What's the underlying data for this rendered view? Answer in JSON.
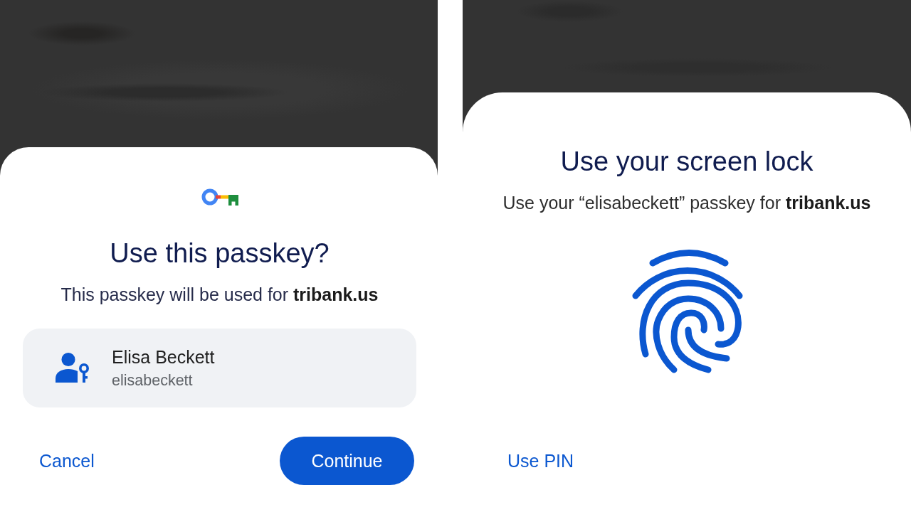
{
  "panels": [
    {
      "kind": "passkey_picker",
      "title": "Use this passkey?",
      "subtitle": "This passkey will be used for **tribank.us**",
      "account": {
        "name": "Elisa Beckett",
        "username": "elisabeckett"
      },
      "cancel_button": "Cancel",
      "continue_button": "Continue"
    },
    {
      "kind": "screen_lock",
      "title": "Use your screen lock",
      "subtitle": "Use your “elisabeckett” passkey for **tribank.us**",
      "use_pin_button": "Use PIN"
    }
  ]
}
